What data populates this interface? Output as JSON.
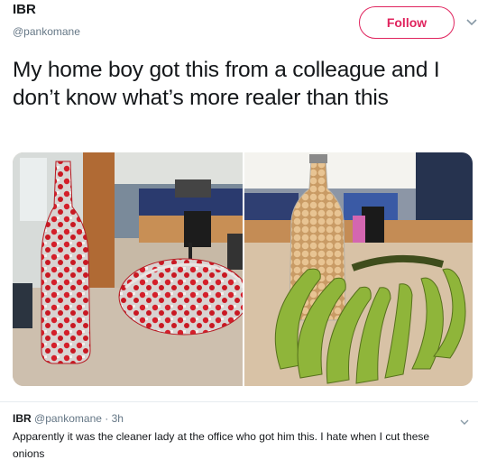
{
  "tweet": {
    "author": {
      "display_name": "IBR",
      "handle": "@pankomane"
    },
    "follow_label": "Follow",
    "text": "My home boy got this from a colleague and I don’t know what’s more realer than this",
    "media": [
      {
        "description_icon": "wrapped-bottle-photo"
      },
      {
        "description_icon": "nuts-and-bananas-photo"
      }
    ]
  },
  "reply": {
    "author": {
      "display_name": "IBR",
      "handle": "@pankomane"
    },
    "separator": "·",
    "time": "3h",
    "text": "Apparently it was the cleaner lady at the office who got him this. I hate when I cut these onions"
  },
  "colors": {
    "follow_accent": "#e0245e",
    "text_primary": "#14171a",
    "text_secondary": "#657786",
    "divider": "#e6ecf0"
  }
}
